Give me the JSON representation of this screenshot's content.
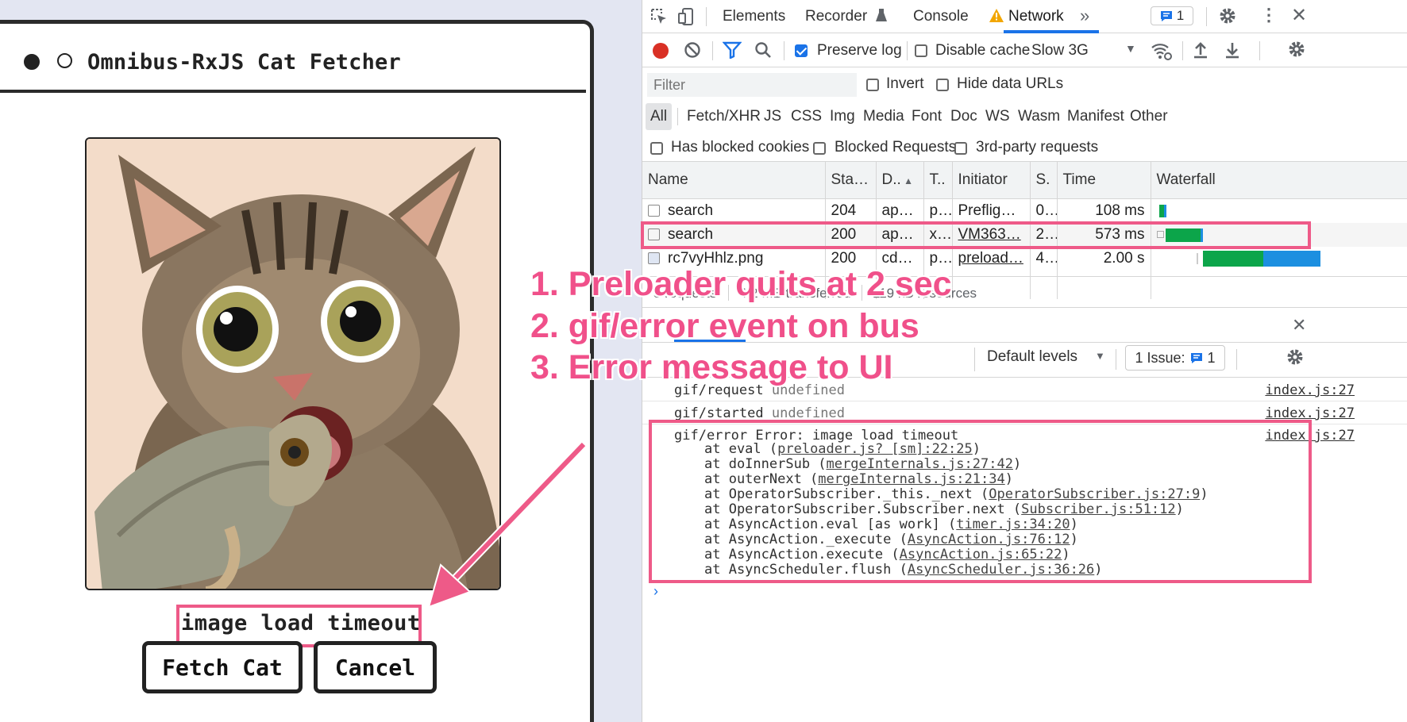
{
  "app": {
    "title": "Omnibus-RxJS Cat Fetcher",
    "message": "image load timeout",
    "fetch_label": "Fetch Cat",
    "cancel_label": "Cancel"
  },
  "devtools": {
    "tabs": [
      "Elements",
      "Recorder",
      "Console",
      "Network"
    ],
    "issues_badge": "1",
    "toolbar": {
      "preserve_log": "Preserve log",
      "disable_cache": "Disable cache",
      "throttle": "Slow 3G"
    },
    "filter": {
      "placeholder": "Filter",
      "invert": "Invert",
      "hide_data_urls": "Hide data URLs"
    },
    "types": [
      "All",
      "Fetch/XHR",
      "JS",
      "CSS",
      "Img",
      "Media",
      "Font",
      "Doc",
      "WS",
      "Wasm",
      "Manifest",
      "Other"
    ],
    "blocked": {
      "cookies": "Has blocked cookies",
      "requests": "Blocked Requests",
      "third_party": "3rd-party requests"
    },
    "columns": [
      "Name",
      "Status",
      "D..",
      "T..",
      "Initiator",
      "S.",
      "Time",
      "Waterfall"
    ],
    "requests": [
      {
        "name": "search",
        "status": "204",
        "domain": "ap…",
        "type": "p…",
        "initiator": "Prefligh…",
        "size": "0…",
        "time": "108 ms"
      },
      {
        "name": "search",
        "status": "200",
        "domain": "ap…",
        "type": "xhr",
        "initiator": "VM363…",
        "size": "2…",
        "time": "573 ms"
      },
      {
        "name": "rc7vyHhlz.png",
        "status": "200",
        "domain": "cd…",
        "type": "p…",
        "initiator": "preload…",
        "size": "4…",
        "time": "2.00 s"
      }
    ],
    "status_bar": {
      "requests": "3 requests",
      "transferred": "4.2 MB transferred",
      "resources": "119 kB resources"
    },
    "console": {
      "default_levels": "Default levels",
      "issues": "1 Issue:",
      "issues_count": "1",
      "lines": [
        {
          "event": "gif/request",
          "value": "undefined",
          "source": "index.js:27"
        },
        {
          "event": "gif/started",
          "value": "undefined",
          "source": "index.js:27"
        }
      ],
      "error": {
        "head": "gif/error Error: image load timeout",
        "source": "index.js:27",
        "stack": [
          {
            "pre": "at eval (",
            "link": "preloader.js? [sm]:22:25",
            "post": ")"
          },
          {
            "pre": "at doInnerSub (",
            "link": "mergeInternals.js:27:42",
            "post": ")"
          },
          {
            "pre": "at outerNext (",
            "link": "mergeInternals.js:21:34",
            "post": ")"
          },
          {
            "pre": "at OperatorSubscriber._this._next (",
            "link": "OperatorSubscriber.js:27:9",
            "post": ")"
          },
          {
            "pre": "at OperatorSubscriber.Subscriber.next (",
            "link": "Subscriber.js:51:12",
            "post": ")"
          },
          {
            "pre": "at AsyncAction.eval [as work] (",
            "link": "timer.js:34:20",
            "post": ")"
          },
          {
            "pre": "at AsyncAction._execute (",
            "link": "AsyncAction.js:76:12",
            "post": ")"
          },
          {
            "pre": "at AsyncAction.execute (",
            "link": "AsyncAction.js:65:22",
            "post": ")"
          },
          {
            "pre": "at AsyncScheduler.flush (",
            "link": "AsyncScheduler.js:36:26",
            "post": ")"
          }
        ]
      }
    }
  },
  "annotations": [
    "1. Preloader quits at 2 sec",
    "2. gif/error event on bus",
    "3. Error message to UI"
  ],
  "colors": {
    "highlight": "#ee5a88",
    "annotation": "#f0508a",
    "accent": "#1a73e8",
    "waterfall_green": "#0ca54a",
    "waterfall_blue": "#1c8fe0"
  }
}
